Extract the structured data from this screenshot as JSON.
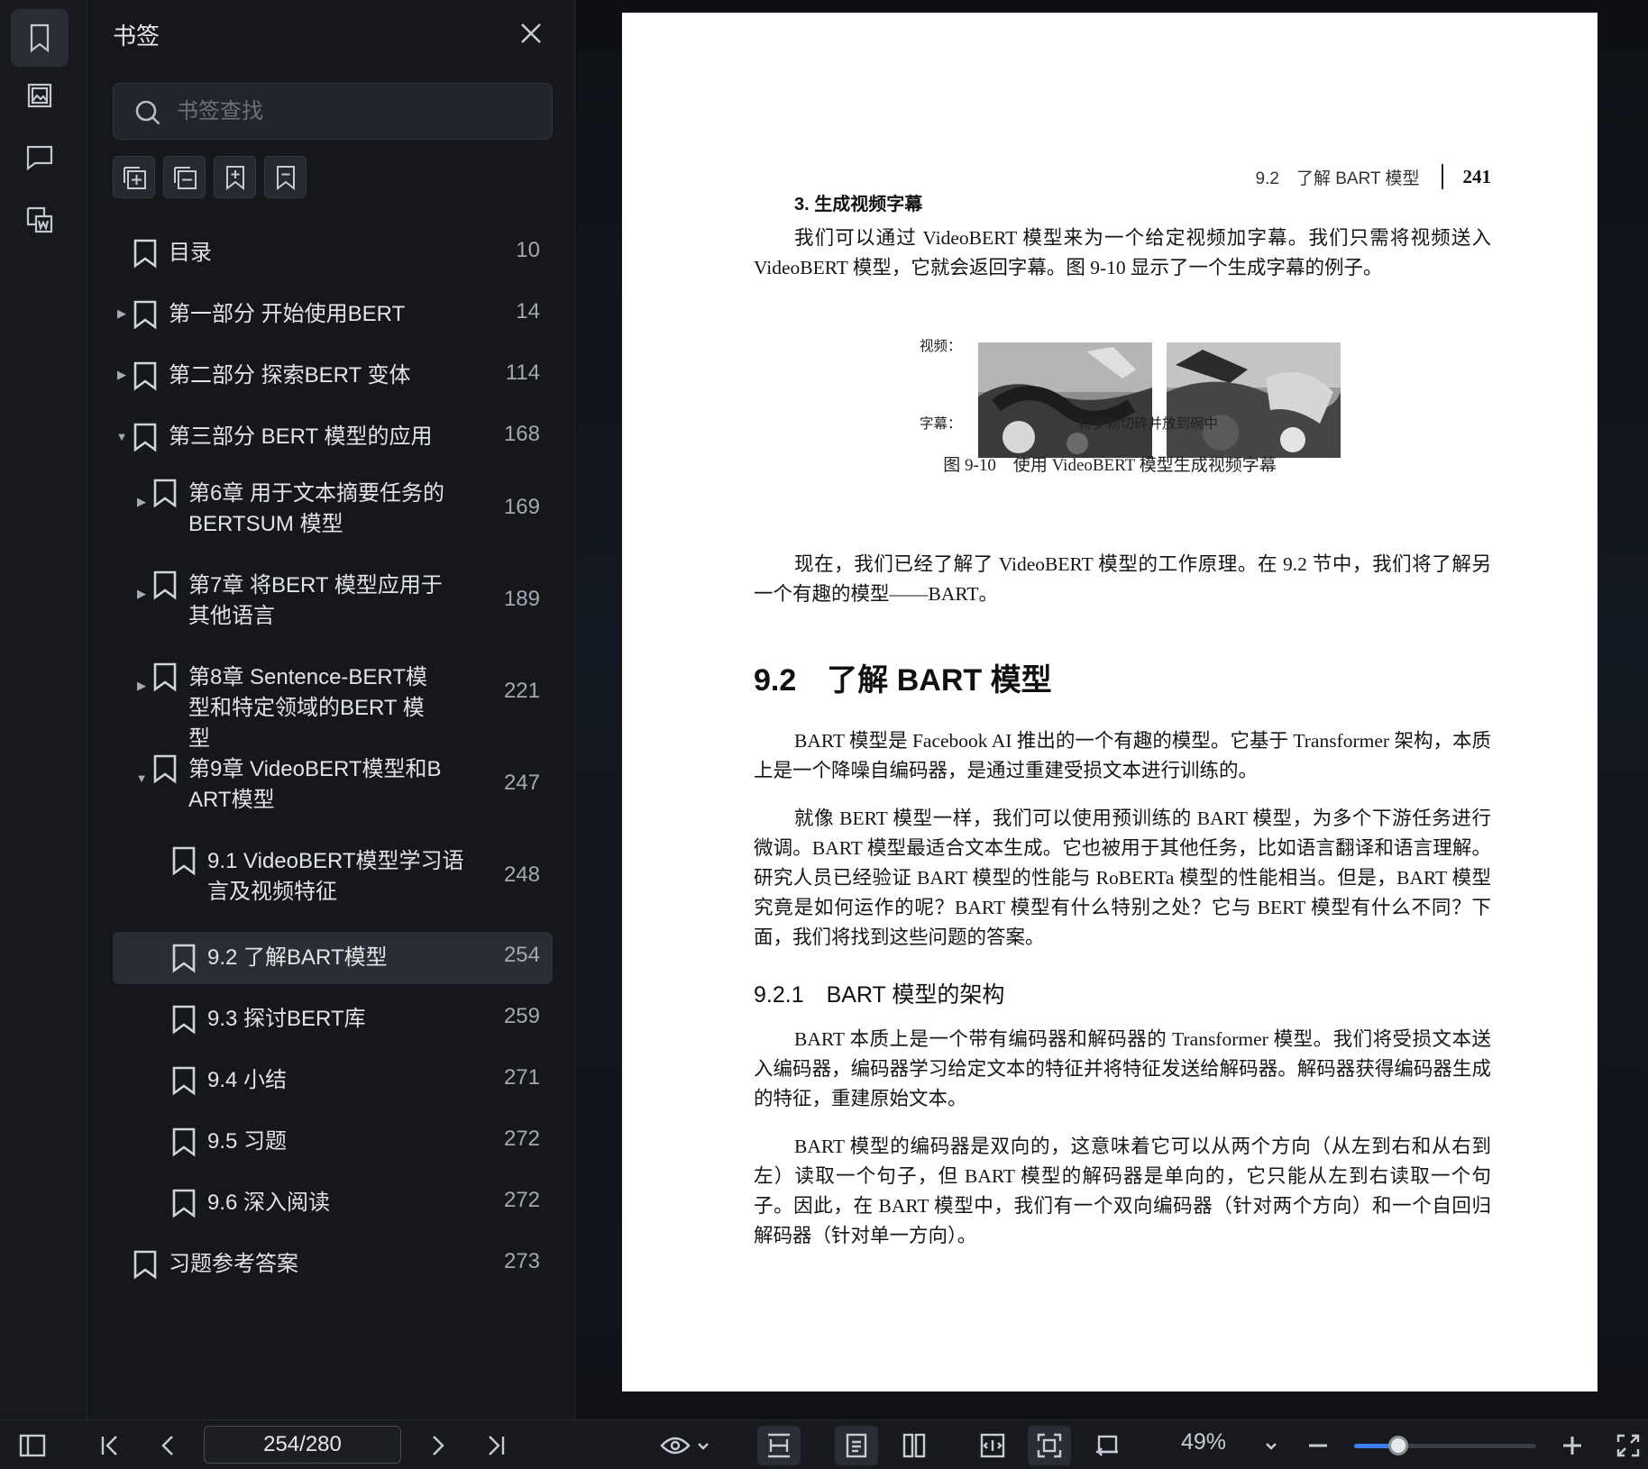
{
  "sidebar_panel": {
    "title": "书签",
    "search_placeholder": "书签查找",
    "bookmarks": [
      {
        "label": "目录",
        "page": "10",
        "level": 0,
        "arrow": ""
      },
      {
        "label": "第一部分 开始使用BERT",
        "page": "14",
        "level": 0,
        "arrow": "collapsed"
      },
      {
        "label": "第二部分 探索BERT 变体",
        "page": "114",
        "level": 0,
        "arrow": "collapsed"
      },
      {
        "label": "第三部分 BERT 模型的应用",
        "page": "168",
        "level": 0,
        "arrow": "expanded"
      },
      {
        "label": "第6章 用于文本摘要任务的BERTSUM 模型",
        "page": "169",
        "level": 1,
        "arrow": "collapsed"
      },
      {
        "label": "第7章 将BERT 模型应用于其他语言",
        "page": "189",
        "level": 1,
        "arrow": "collapsed"
      },
      {
        "label": "第8章 Sentence-BERT模型和特定领域的BERT 模型",
        "page": "221",
        "level": 1,
        "arrow": "collapsed"
      },
      {
        "label": "第9章 VideoBERT模型和BART模型",
        "page": "247",
        "level": 1,
        "arrow": "expanded"
      },
      {
        "label": "9.1 VideoBERT模型学习语言及视频特征",
        "page": "248",
        "level": 2,
        "arrow": ""
      },
      {
        "label": "9.2 了解BART模型",
        "page": "254",
        "level": 2,
        "arrow": "",
        "selected": true
      },
      {
        "label": "9.3 探讨BERT库",
        "page": "259",
        "level": 2,
        "arrow": ""
      },
      {
        "label": "9.4 小结",
        "page": "271",
        "level": 2,
        "arrow": ""
      },
      {
        "label": "9.5 习题",
        "page": "272",
        "level": 2,
        "arrow": ""
      },
      {
        "label": "9.6 深入阅读",
        "page": "272",
        "level": 2,
        "arrow": ""
      },
      {
        "label": "习题参考答案",
        "page": "273",
        "level": 0,
        "arrow": ""
      }
    ]
  },
  "document": {
    "running_head": "9.2　了解 BART 模型",
    "page_number": "241",
    "subheading": "3. 生成视频字幕",
    "para1": "我们可以通过 VideoBERT 模型来为一个给定视频加字幕。我们只需将视频送入 VideoBERT 模型，它就会返回字幕。图 9-10 显示了一个生成字幕的例子。",
    "figure": {
      "video_label": "视频：",
      "caption_label": "字幕：",
      "subtitle_text": "将罗勒切碎并放到碗中",
      "caption": "图 9-10　使用 VideoBERT 模型生成视频字幕"
    },
    "para2": "现在，我们已经了解了 VideoBERT 模型的工作原理。在 9.2 节中，我们将了解另一个有趣的模型——BART。",
    "section_title": "9.2　了解 BART 模型",
    "para3": "BART 模型是 Facebook AI 推出的一个有趣的模型。它基于 Transformer 架构，本质上是一个降噪自编码器，是通过重建受损文本进行训练的。",
    "para4": "就像 BERT 模型一样，我们可以使用预训练的 BART 模型，为多个下游任务进行微调。BART 模型最适合文本生成。它也被用于其他任务，比如语言翻译和语言理解。研究人员已经验证 BART 模型的性能与 RoBERTa 模型的性能相当。但是，BART 模型究竟是如何运作的呢？BART 模型有什么特别之处？它与 BERT 模型有什么不同？下面，我们将找到这些问题的答案。",
    "subsection_title": "9.2.1　BART 模型的架构",
    "para5": "BART 本质上是一个带有编码器和解码器的 Transformer 模型。我们将受损文本送入编码器，编码器学习给定文本的特征并将特征发送给解码器。解码器获得编码器生成的特征，重建原始文本。",
    "para6": "BART 模型的编码器是双向的，这意味着它可以从两个方向（从左到右和从右到左）读取一个句子，但 BART 模型的解码器是单向的，它只能从左到右读取一个句子。因此，在 BART 模型中，我们有一个双向编码器（针对两个方向）和一个自回归解码器（针对单一方向）。"
  },
  "toolbar": {
    "page_indicator": "254/280",
    "zoom": "49%",
    "zoom_level": 0.49
  },
  "colors": {
    "accent": "#3d7bf3",
    "background": "#101218",
    "panel": "#15171d",
    "selected_row": "#2a2d34"
  }
}
